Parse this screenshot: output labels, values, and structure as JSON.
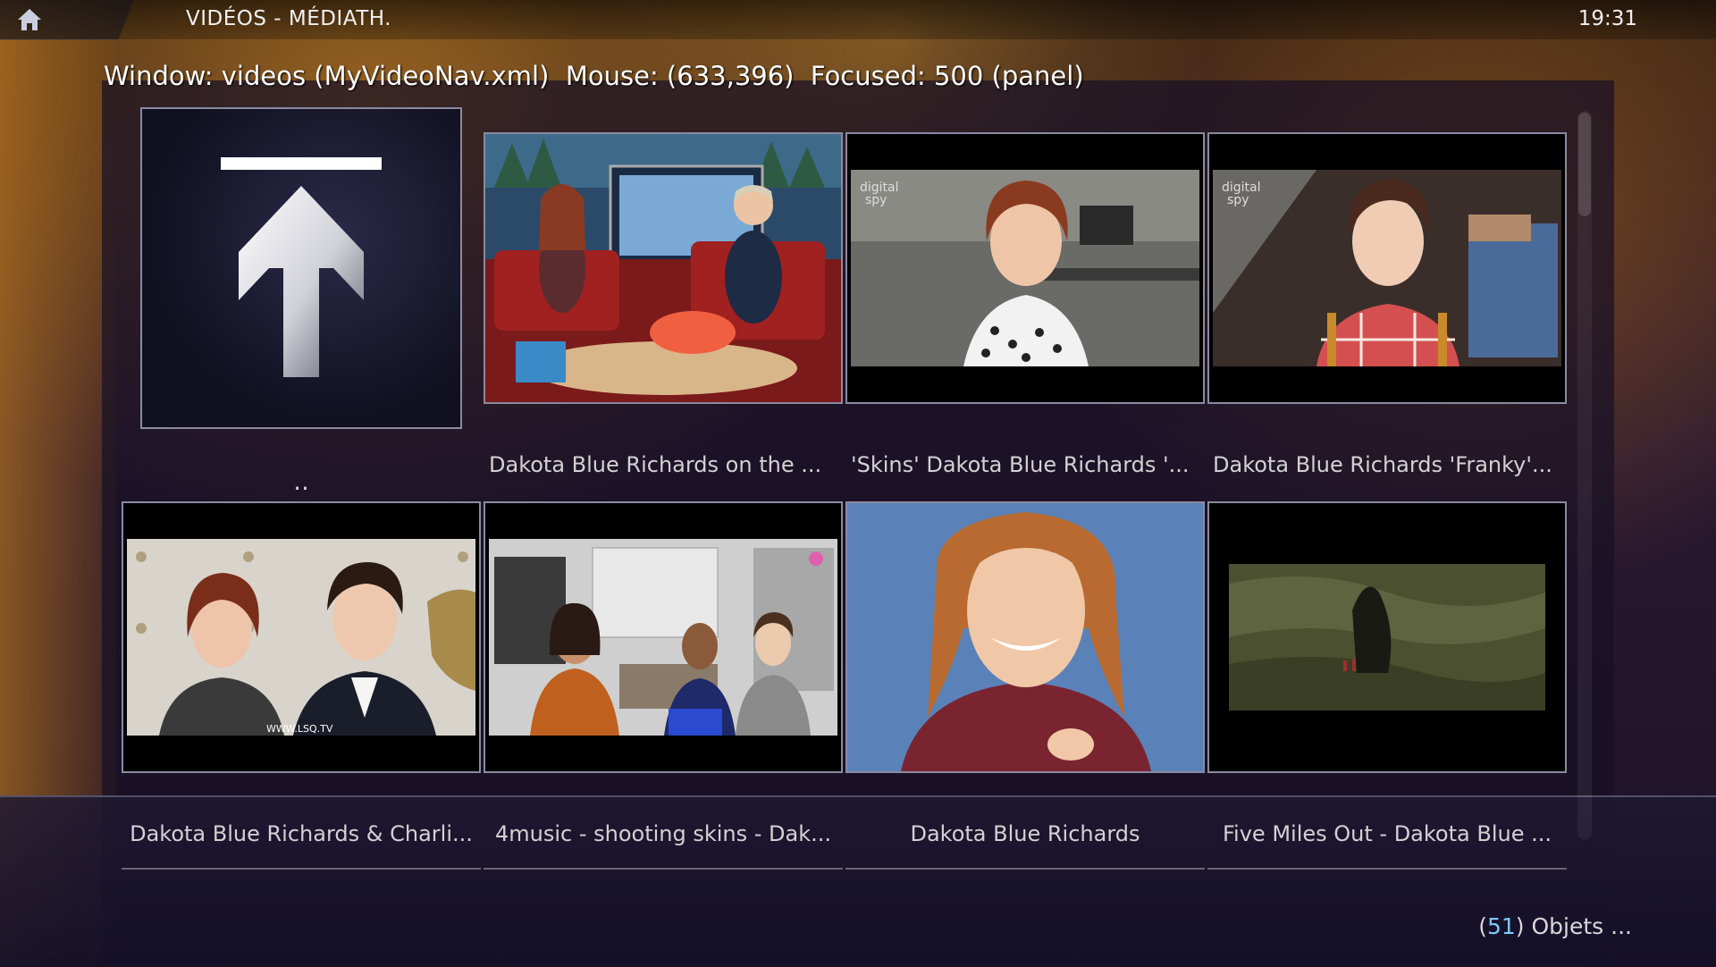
{
  "header": {
    "window_title": "VIDÉOS - MÉDIATH.",
    "clock": "19:31"
  },
  "debug": {
    "text": "Window: videos (MyVideoNav.xml)  Mouse: (633,396)  Focused: 500 (panel)"
  },
  "parent_item": {
    "label": ".."
  },
  "items": [
    {
      "label": "Dakota Blue Richards on the ..."
    },
    {
      "label": "'Skins' Dakota Blue Richards '..."
    },
    {
      "label": "Dakota Blue Richards 'Franky'..."
    },
    {
      "label": "Dakota Blue Richards & Charli..."
    },
    {
      "label": "4music - shooting skins - Dak..."
    },
    {
      "label": "Dakota Blue Richards"
    },
    {
      "label": "Five Miles Out - Dakota Blue ..."
    }
  ],
  "footer": {
    "count_open": "(",
    "count": "51",
    "count_close": ") Objets ..."
  },
  "icons": {
    "home": "home-icon",
    "up": "parent-folder-arrow-icon"
  },
  "colors": {
    "accent_count": "#7fc8ff",
    "thumb_border": "#8a8aa0"
  }
}
